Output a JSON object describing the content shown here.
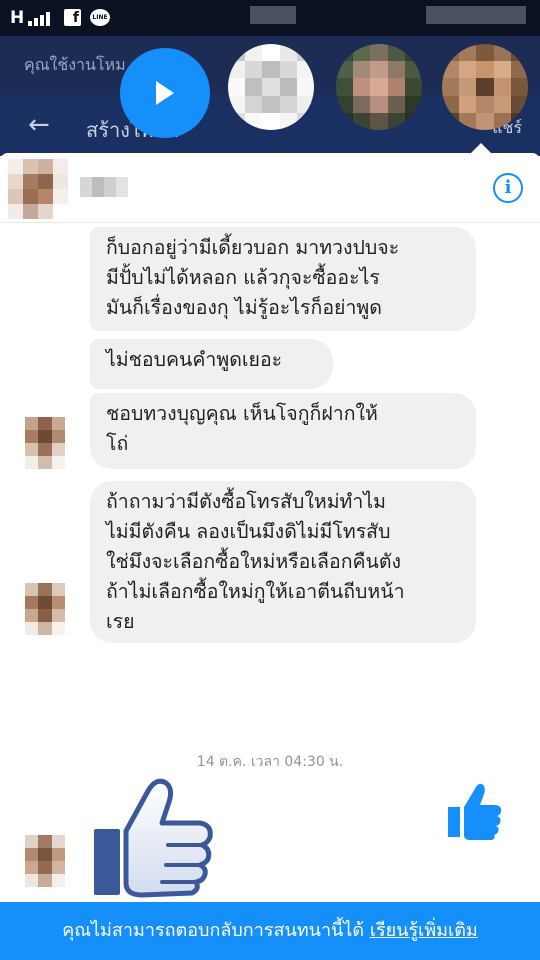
{
  "status_bar": {
    "network": "H",
    "fb_icon_letter": "f",
    "line_icon_label": "LINE"
  },
  "background_app": {
    "notice_text": "คุณใช้งานโหม",
    "nav_title": "สร้างโพสต์",
    "nav_right": "แชร์"
  },
  "chat": {
    "messages": [
      "ก็บอกอยู่ว่ามีเดี้ยวบอก มาทวงปบจะ\nมีปั้บไม่ได้หลอก แล้วกุจะซื้ออะไร\nมันก็เรื่องของกุ ไม่รู้อะไรก็อย่าพูด",
      "ไม่ชอบคนคำพูดเยอะ",
      "ชอบทวงบุญคุณ เห็นโจกูก็ฝากให้\nโถ่",
      "ถ้าถามว่ามีตังซื้อโทรสับใหม่ทำไม\nไม่มีตังคืน ลองเป็นมึงดิไม่มีโทรสับ\nใช่มึงจะเลือกซื้อใหม่หรือเลือกคืนตัง\nถ้าไม่เลือกซื้อใหม่กูให้เอาตีนถีบหน้า\nเรย"
    ],
    "timestamp": "14 ต.ค. เวลา 04:30 น."
  },
  "bottom_bar": {
    "text": "คุณไม่สามารถตอบกลับการสนทนานี้ได้ ",
    "link": "เรียนรู้เพิ่มเติม"
  },
  "colors": {
    "messenger_blue": "#1590fb",
    "bubble_gray": "#f1f0f0",
    "facebook_like_blue": "#3b5998"
  },
  "icons": {
    "info": "info-icon",
    "like_small": "thumbs-up-icon",
    "like_big": "thumbs-up-icon",
    "back": "back-arrow-icon"
  }
}
